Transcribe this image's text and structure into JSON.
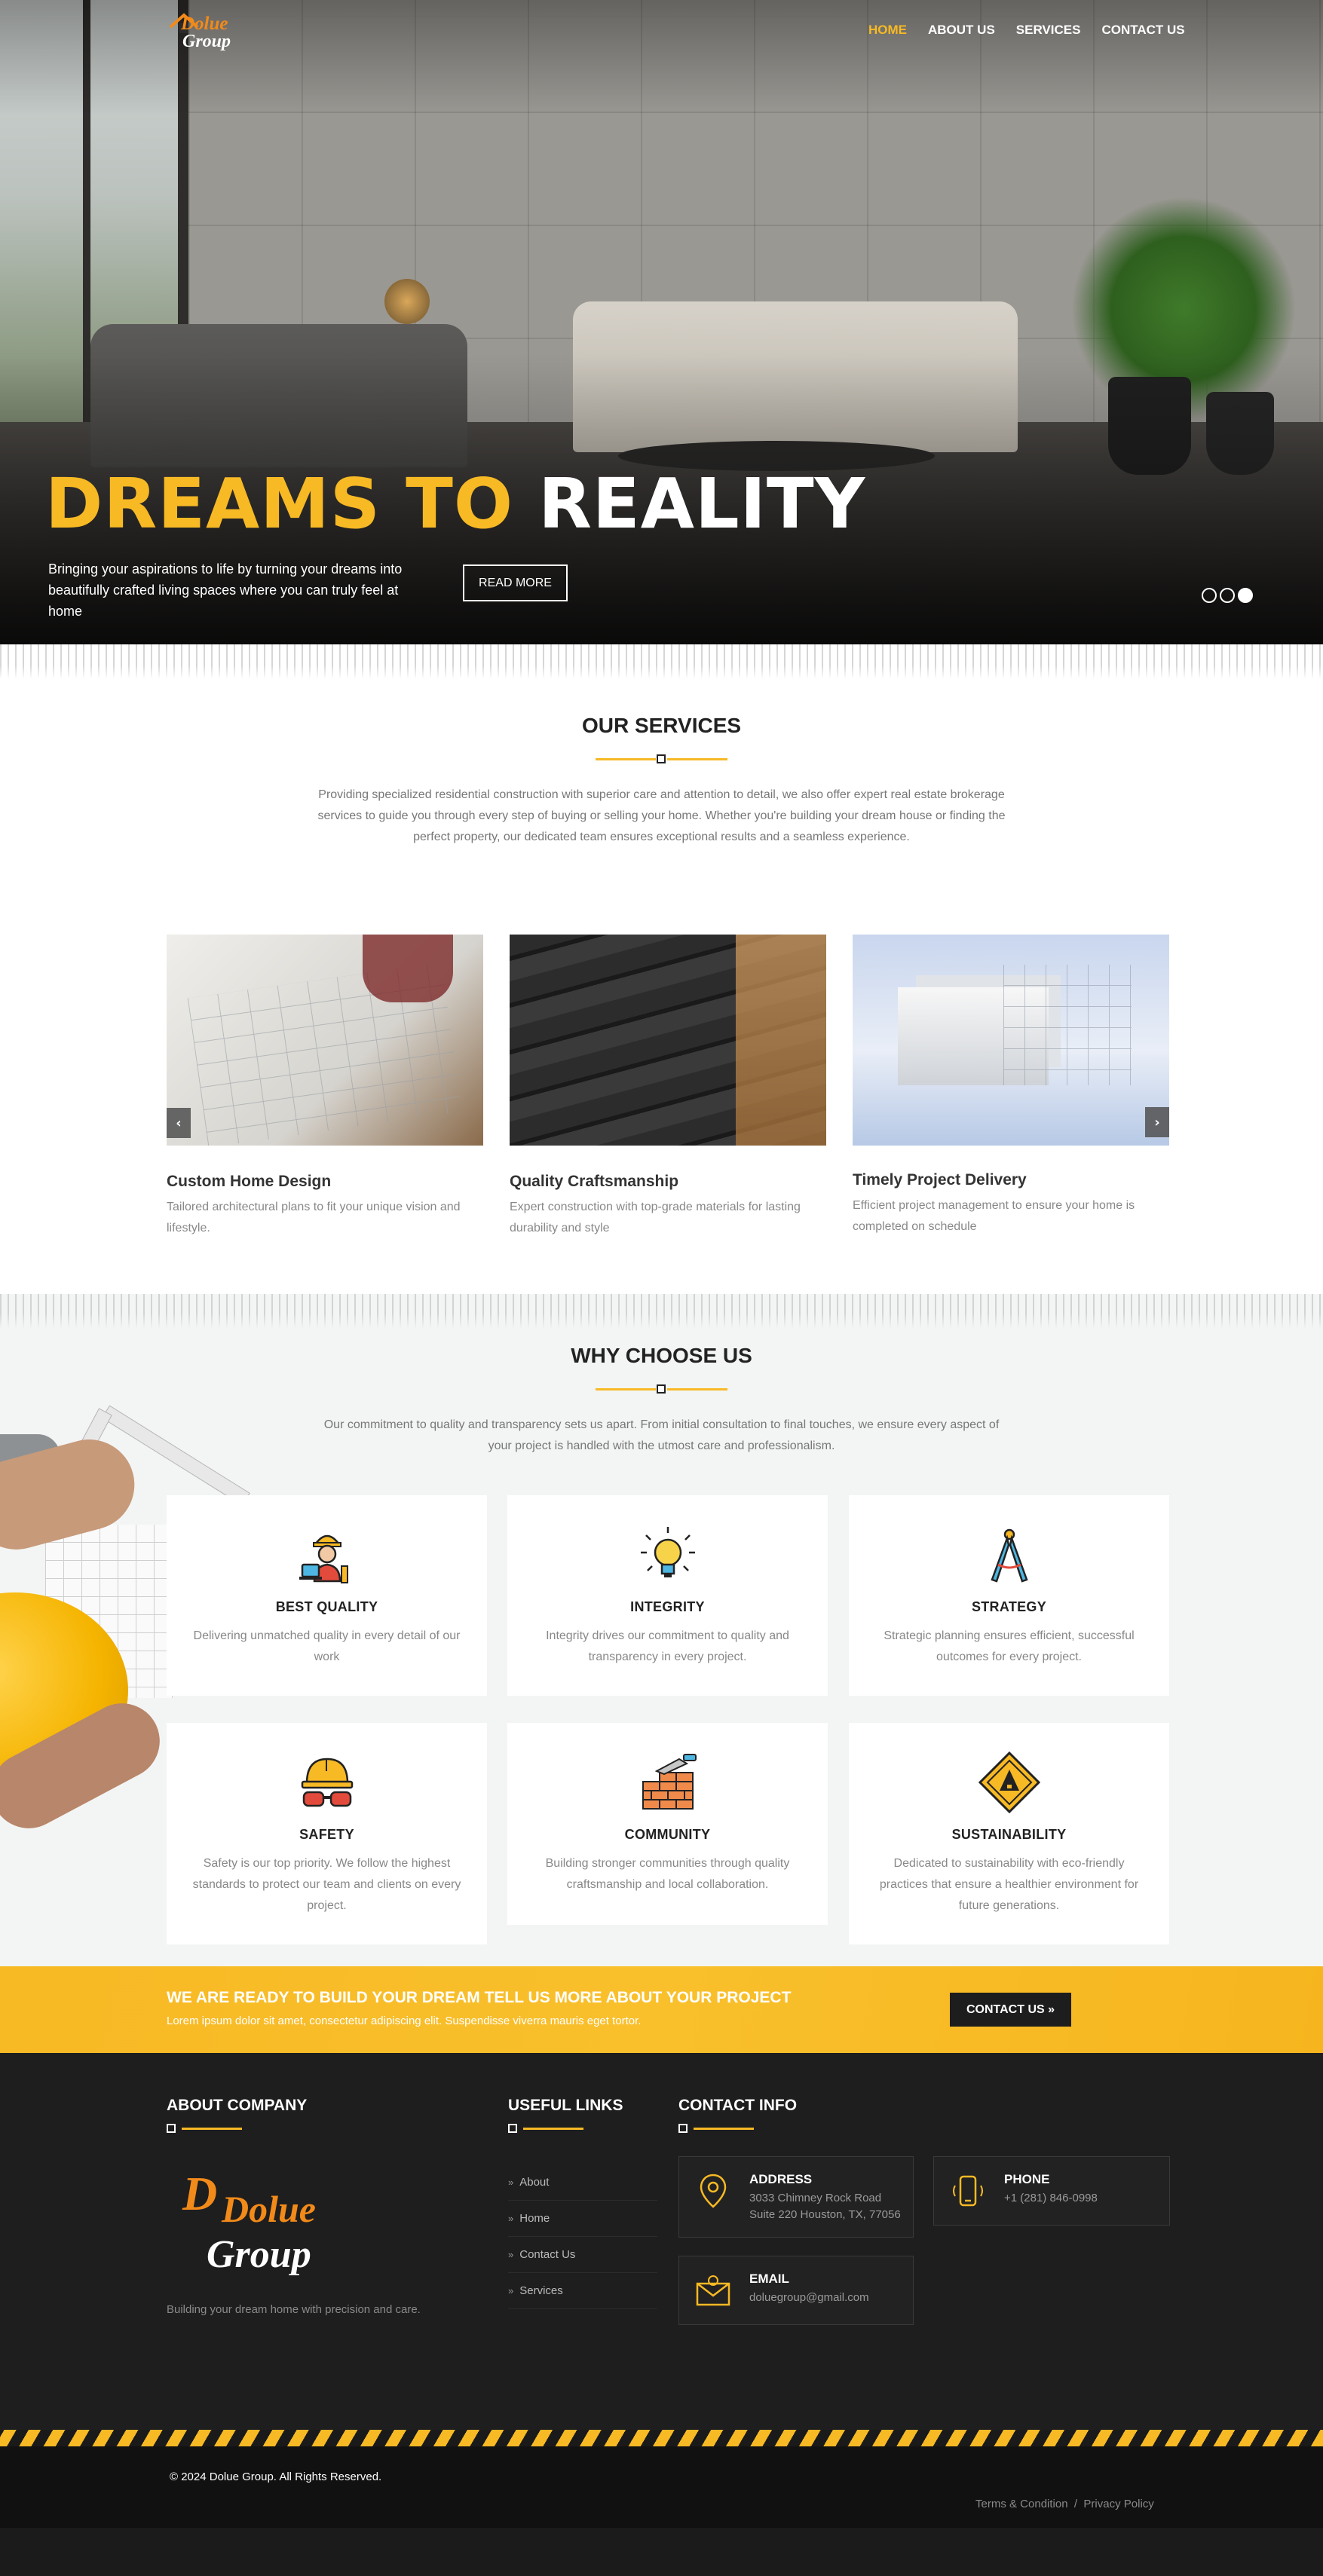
{
  "brand": {
    "logo_line1": "Dolue",
    "logo_line2": "Group"
  },
  "nav": {
    "items": [
      "HOME",
      "ABOUT US",
      "SERVICES",
      "CONTACT US"
    ],
    "active": "HOME"
  },
  "hero": {
    "title_highlight": "DREAMS TO",
    "title_rest": "REALITY",
    "subtitle": "Bringing your aspirations to life by turning your dreams into beautifully crafted living spaces where you can truly feel at home",
    "button": "READ MORE",
    "slides_total": 3,
    "slide_active": 3
  },
  "services": {
    "title": "OUR SERVICES",
    "intro": "Providing specialized residential construction with superior care and attention to detail, we also offer expert real estate brokerage services to guide you through every step of buying or selling your home. Whether you're building your dream house or finding the perfect property, our dedicated team ensures exceptional results and a seamless experience.",
    "cards": [
      {
        "title": "Custom Home Design",
        "text": "Tailored architectural plans to fit your unique vision and lifestyle."
      },
      {
        "title": "Quality Craftsmanship",
        "text": "Expert construction with top-grade materials for lasting durability and style"
      },
      {
        "title": "Timely Project Delivery",
        "text": "Efficient project management to ensure your home is completed on schedule"
      }
    ],
    "prev_icon": "chevron-left-icon",
    "next_icon": "chevron-right-icon"
  },
  "why": {
    "title": "WHY CHOOSE US",
    "intro": "Our commitment to quality and transparency sets us apart. From initial consultation to final touches, we ensure every aspect of your project is handled with the utmost care and professionalism.",
    "features": [
      {
        "title": "BEST QUALITY",
        "text": "Delivering unmatched quality in every detail of our work",
        "icon": "engineer-icon"
      },
      {
        "title": "INTEGRITY",
        "text": "Integrity drives our commitment to quality and transparency in every project.",
        "icon": "lightbulb-icon"
      },
      {
        "title": "STRATEGY",
        "text": "Strategic planning ensures efficient, successful outcomes for every project.",
        "icon": "compass-icon"
      },
      {
        "title": "SAFETY",
        "text": "Safety is our top priority. We follow the highest standards to protect our team and clients on every project.",
        "icon": "safety-helmet-icon"
      },
      {
        "title": "COMMUNITY",
        "text": "Building stronger communities through quality craftsmanship and local collaboration.",
        "icon": "brick-wall-icon"
      },
      {
        "title": "SUSTAINABILITY",
        "text": "Dedicated to sustainability with eco-friendly practices that ensure a healthier environment for future generations.",
        "icon": "warning-sign-icon"
      }
    ]
  },
  "cta": {
    "title": "WE ARE READY TO BUILD YOUR DREAM TELL US MORE ABOUT YOUR PROJECT",
    "text": "Lorem ipsum dolor sit amet, consectetur adipiscing elit. Suspendisse viverra mauris eget tortor.",
    "button": "CONTACT US »"
  },
  "footer": {
    "about_title": "ABOUT COMPANY",
    "about_text": "Building your dream home with precision and care.",
    "links_title": "USEFUL LINKS",
    "links": [
      "About",
      "Home",
      "Contact Us",
      "Services"
    ],
    "contact_title": "CONTACT INFO",
    "address_label": "ADDRESS",
    "address_line1": "3033 Chimney Rock Road",
    "address_line2": "Suite 220 Houston, TX, 77056",
    "phone_label": "PHONE",
    "phone_value": "+1 (281) 846-0998",
    "email_label": "EMAIL",
    "email_value": "doluegroup@gmail.com",
    "copyright": "© 2024 Dolue Group. All Rights Reserved.",
    "terms": "Terms & Condition",
    "separator": "/",
    "privacy": "Privacy Policy"
  },
  "colors": {
    "accent": "#f7b924",
    "logo_orange": "#f28a1a",
    "footer_bg": "#1e1e1e",
    "section_bg": "#f3f5f4"
  }
}
